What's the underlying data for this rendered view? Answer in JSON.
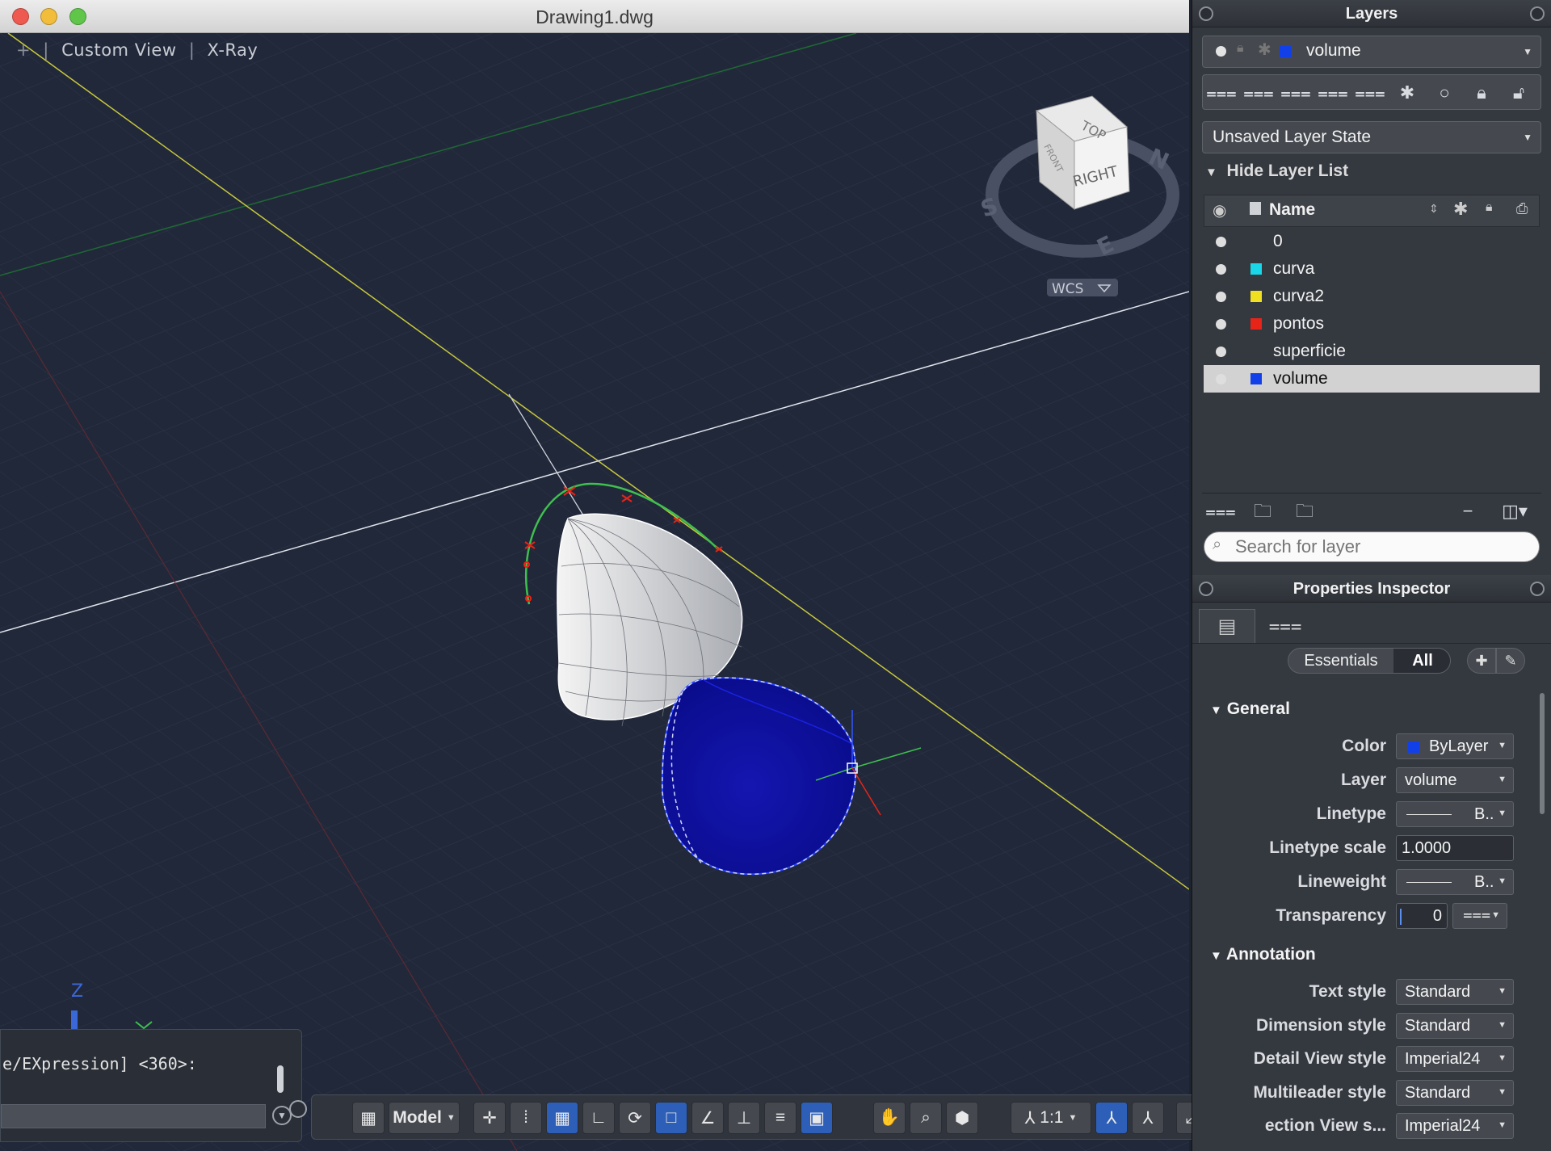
{
  "window": {
    "title": "Drawing1.dwg"
  },
  "viewport": {
    "view_controls": [
      "+",
      "|",
      "Custom View",
      "|",
      "X-Ray"
    ],
    "viewcube": {
      "top": "TOP",
      "right": "RIGHT",
      "front": "FRONT",
      "compass_n": "N",
      "compass_s": "S",
      "compass_e": "E",
      "wcs": "WCS"
    },
    "ucs_z": "Z",
    "colors": {
      "background": "#21283a",
      "grid": "#2b3347",
      "volume": "#0a10d8",
      "yellow_axis": "#c8c83a",
      "green_curve": "#3fbf4f"
    }
  },
  "command_line": {
    "text": "e/EXpression] <360>:",
    "input_value": ""
  },
  "status_bar": {
    "model": "Model",
    "scale": "1:1"
  },
  "layers_panel": {
    "title": "Layers",
    "current_layer": {
      "name": "volume",
      "color": "#1240e8"
    },
    "layer_state": "Unsaved Layer State",
    "toggle": "Hide Layer List",
    "column_name": "Name",
    "layers": [
      {
        "name": "0",
        "color": ""
      },
      {
        "name": "curva",
        "color": "#19d7e8"
      },
      {
        "name": "curva2",
        "color": "#f0e020"
      },
      {
        "name": "pontos",
        "color": "#e82418"
      },
      {
        "name": "superficie",
        "color": ""
      },
      {
        "name": "volume",
        "color": "#1240e8",
        "selected": true
      }
    ],
    "search_placeholder": "Search for layer"
  },
  "properties_panel": {
    "title": "Properties Inspector",
    "tabs": {
      "essentials": "Essentials",
      "all": "All"
    },
    "general": {
      "title": "General",
      "color_label": "Color",
      "color_value": "ByLayer",
      "color_swatch": "#1240e8",
      "layer_label": "Layer",
      "layer_value": "volume",
      "linetype_label": "Linetype",
      "linetype_value": "B..",
      "linetype_scale_label": "Linetype scale",
      "linetype_scale_value": "1.0000",
      "lineweight_label": "Lineweight",
      "lineweight_value": "B..",
      "transparency_label": "Transparency",
      "transparency_value": "0"
    },
    "annotation": {
      "title": "Annotation",
      "text_style_label": "Text style",
      "text_style_value": "Standard",
      "dimension_style_label": "Dimension style",
      "dimension_style_value": "Standard",
      "detail_view_style_label": "Detail View style",
      "detail_view_style_value": "Imperial24",
      "multileader_style_label": "Multileader style",
      "multileader_style_value": "Standard",
      "section_view_style_label": "ection View s...",
      "section_view_style_value": "Imperial24"
    }
  }
}
